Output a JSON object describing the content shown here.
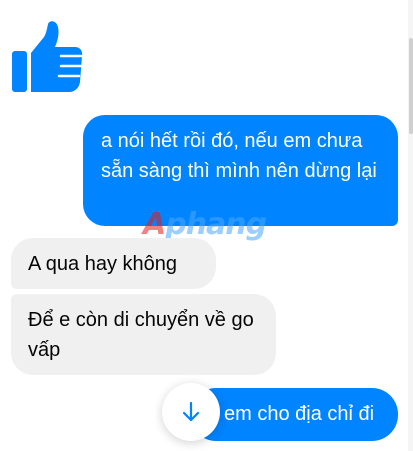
{
  "colors": {
    "accent": "#0084ff",
    "incoming_bubble": "#f0f0f0",
    "incoming_text": "#050505",
    "outgoing_text": "#ffffff"
  },
  "sticker": {
    "icon": "thumbs-up-icon"
  },
  "messages": [
    {
      "direction": "outgoing",
      "text": "a nói hết rồi đó, nếu em chưa sẵn sàng thì mình nên dừng lại"
    },
    {
      "direction": "incoming",
      "text": "A qua hay không"
    },
    {
      "direction": "incoming",
      "text": "Để e còn di chuyển về go vấp"
    },
    {
      "direction": "outgoing",
      "text": "em cho địa chỉ đi"
    }
  ],
  "watermark": {
    "first": "A",
    "rest": "phang"
  },
  "scroll_button": {
    "icon": "arrow-down-icon"
  }
}
